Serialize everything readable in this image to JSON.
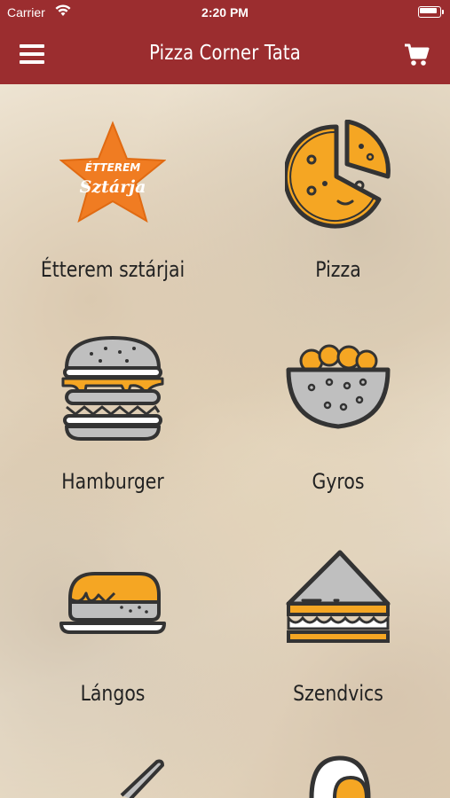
{
  "status_bar": {
    "carrier": "Carrier",
    "time": "2:20 PM"
  },
  "nav": {
    "title": "Pizza Corner Tata",
    "menu_icon": "hamburger-menu-icon",
    "cart_icon": "shopping-cart-icon"
  },
  "badge": {
    "line1": "ÉTTEREM",
    "line2": "Sztárja"
  },
  "categories": [
    {
      "label": "Étterem sztárjai",
      "icon": "star-badge-icon"
    },
    {
      "label": "Pizza",
      "icon": "pizza-icon"
    },
    {
      "label": "Hamburger",
      "icon": "hamburger-icon"
    },
    {
      "label": "Gyros",
      "icon": "gyros-icon"
    },
    {
      "label": "Lángos",
      "icon": "langos-icon"
    },
    {
      "label": "Szendvics",
      "icon": "sandwich-icon"
    }
  ],
  "colors": {
    "brand": "#9b2d2f",
    "accent": "#f5a623",
    "ink": "#333333"
  }
}
